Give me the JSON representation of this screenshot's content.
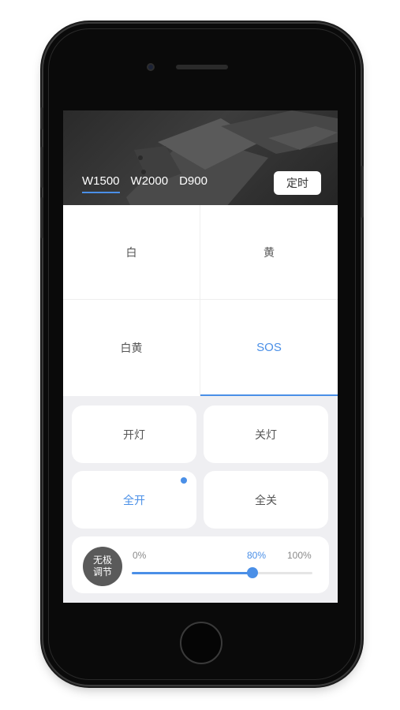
{
  "header": {
    "tabs": [
      {
        "label": "W1500",
        "active": true
      },
      {
        "label": "W2000",
        "active": false
      },
      {
        "label": "D900",
        "active": false
      }
    ],
    "timer_label": "定时"
  },
  "modes": [
    {
      "label": "白",
      "selected": false
    },
    {
      "label": "黄",
      "selected": false
    },
    {
      "label": "白黄",
      "selected": false
    },
    {
      "label": "SOS",
      "selected": true
    }
  ],
  "controls": {
    "light_on": "开灯",
    "light_off": "关灯",
    "all_on": "全开",
    "all_off": "全关",
    "all_on_indicator": true
  },
  "dimmer": {
    "badge_line1": "无极",
    "badge_line2": "调节",
    "min_label": "0%",
    "current_label": "80%",
    "max_label": "100%",
    "value_fraction": 0.67
  },
  "colors": {
    "accent": "#4a8fe7",
    "header_bg": "#2e2e2e",
    "badge_bg": "#5a5a5a"
  }
}
